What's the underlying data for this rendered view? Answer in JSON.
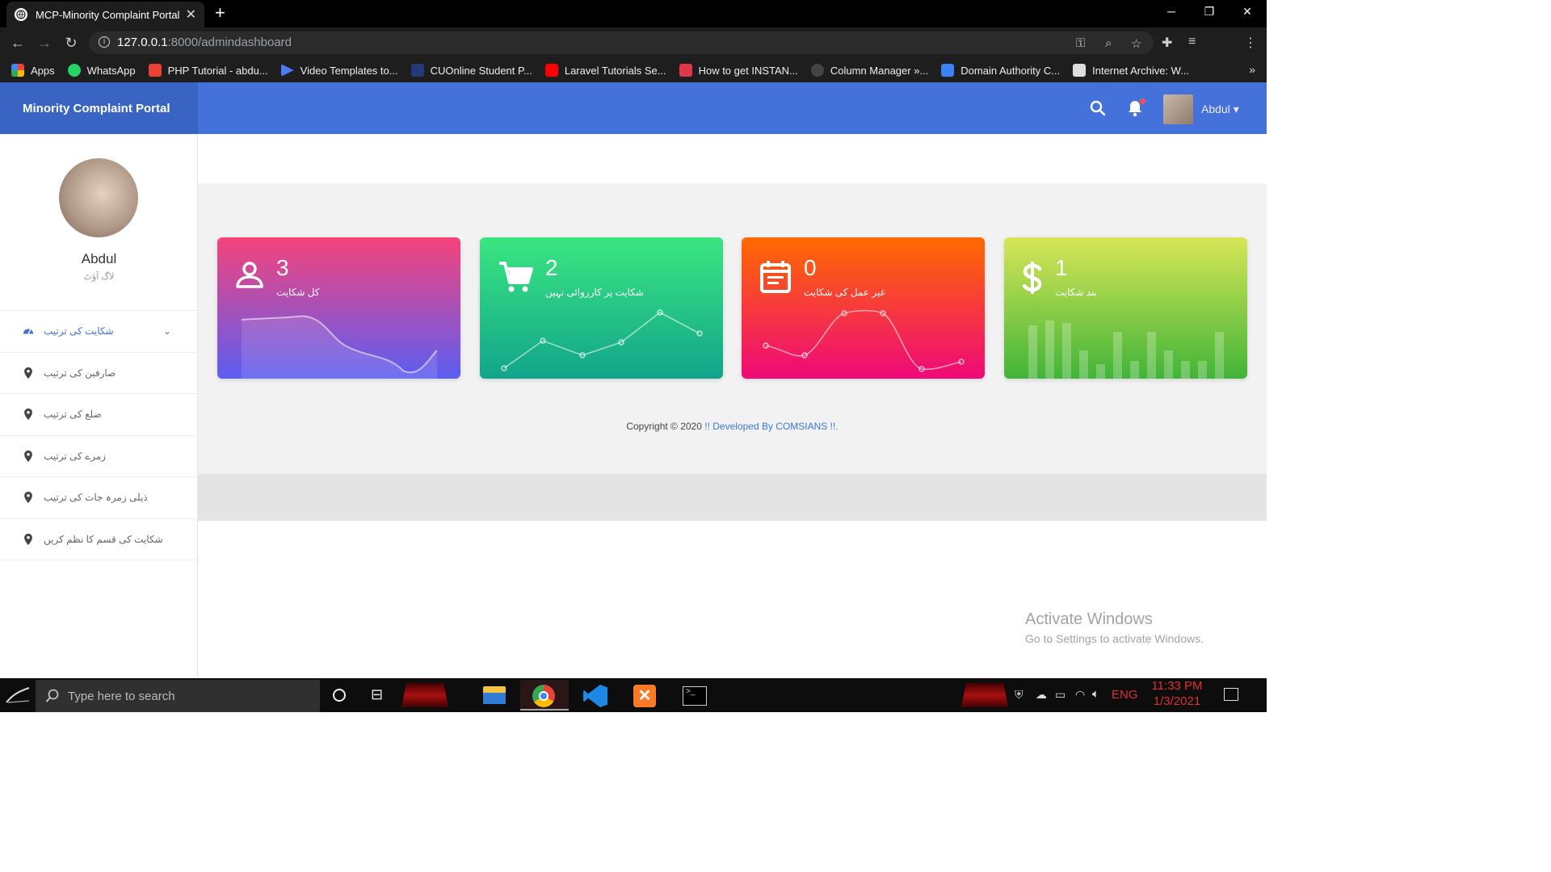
{
  "browser": {
    "tab_title": "MCP-Minority Complaint Portal",
    "tab_close": "✕",
    "new_tab": "+",
    "url_host": "127.0.0.1",
    "url_path": ":8000/admindashboard",
    "bookmarks": [
      {
        "label": "Apps",
        "icon_color": "#e44"
      },
      {
        "label": "WhatsApp",
        "icon_color": "#25d366"
      },
      {
        "label": "PHP Tutorial - abdu...",
        "icon_color": "#ea4335"
      },
      {
        "label": "Video Templates to...",
        "icon_color": "#4b7cf3"
      },
      {
        "label": "CUOnline Student P...",
        "icon_color": "#223a7a"
      },
      {
        "label": "Laravel Tutorials Se...",
        "icon_color": "#ff0000"
      },
      {
        "label": "How to get INSTAN...",
        "icon_color": "#e0374a"
      },
      {
        "label": "Column Manager »...",
        "icon_color": "#333"
      },
      {
        "label": "Domain Authority C...",
        "icon_color": "#3b82f6"
      },
      {
        "label": "Internet Archive: W...",
        "icon_color": "#ddd"
      }
    ],
    "bookmarks_more": "»"
  },
  "header": {
    "brand": "Minority Complaint Portal",
    "user_name": "Abdul ▾"
  },
  "sidebar": {
    "profile_name": "Abdul",
    "logout": "لاگ آؤٹ",
    "items": [
      {
        "label": "شکایت کی ترتیب",
        "icon": "dashboard-icon",
        "active": true
      },
      {
        "label": "صارفین کی ترتیب",
        "icon": "map-marker-icon"
      },
      {
        "label": "ضلع کی ترتیب",
        "icon": "map-marker-icon"
      },
      {
        "label": "زمرے کی ترتیب",
        "icon": "map-marker-icon"
      },
      {
        "label": "ذیلی زمرہ جات کی ترتیب",
        "icon": "map-marker-icon"
      },
      {
        "label": "شکایت کی قسم کا نظم کریں",
        "icon": "map-marker-icon"
      }
    ]
  },
  "cards": [
    {
      "count": "3",
      "label": "کل شکایت",
      "icon": "user-icon",
      "gradient": [
        "#f6437b",
        "#5b5ef2"
      ]
    },
    {
      "count": "2",
      "label": "شکایت پر کارروائی نہیں",
      "icon": "cart-icon",
      "gradient": [
        "#39e07e",
        "#11998e"
      ]
    },
    {
      "count": "0",
      "label": "غیر عمل کی شکایت",
      "icon": "calendar-icon",
      "gradient": [
        "#ff6a00",
        "#ee0979"
      ]
    },
    {
      "count": "1",
      "label": "بند شکایت",
      "icon": "dollar-icon",
      "gradient": [
        "#d5e557",
        "#43b536"
      ]
    }
  ],
  "footer": {
    "copyright": "Copyright © 2020",
    "developed": "!! Developed By COMSIANS !!."
  },
  "watermark": {
    "line1": "Activate Windows",
    "line2": "Go to Settings to activate Windows."
  },
  "taskbar": {
    "search_placeholder": "Type here to search",
    "language": "ENG",
    "time": "11:33 PM",
    "date": "1/3/2021"
  }
}
